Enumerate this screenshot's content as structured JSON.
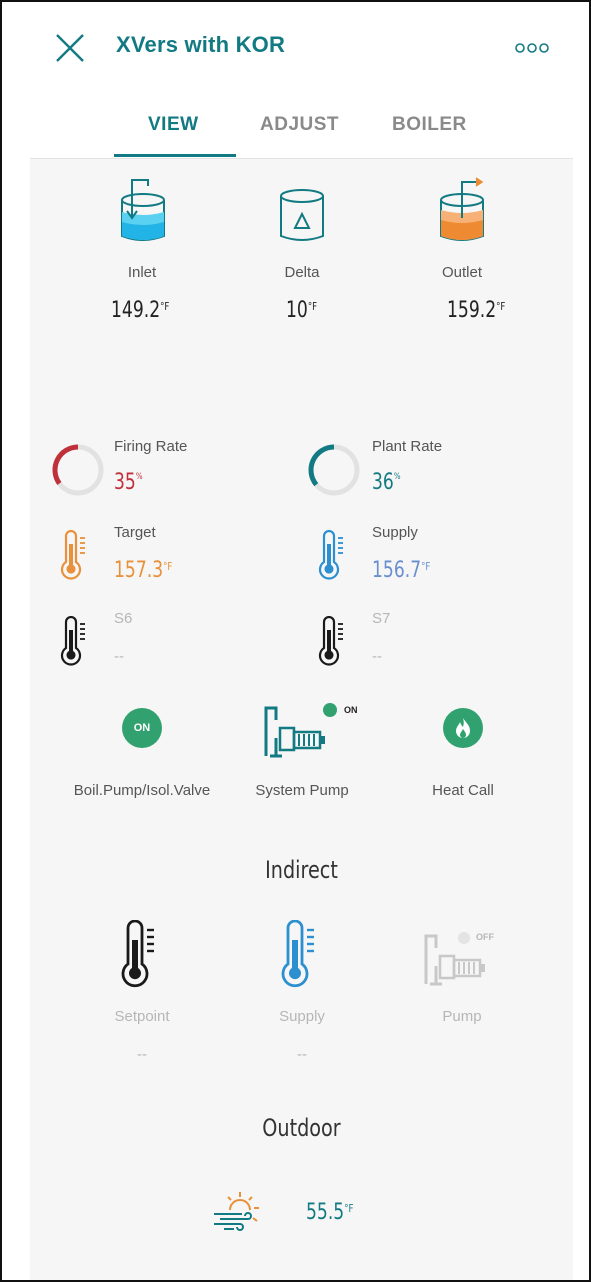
{
  "header": {
    "title": "XVers with KOR",
    "tabs": [
      "VIEW",
      "ADJUST",
      "BOILER"
    ]
  },
  "tank": {
    "inlet_label": "Inlet",
    "inlet_value": "149.2",
    "delta_label": "Delta",
    "delta_value": "10",
    "outlet_label": "Outlet",
    "outlet_value": "159.2",
    "unit": "°F"
  },
  "rates": {
    "firing_label": "Firing Rate",
    "firing_value": "35",
    "firing_percent": 35,
    "plant_label": "Plant Rate",
    "plant_value": "36",
    "plant_percent": 36,
    "pct": "%"
  },
  "temps": {
    "target_label": "Target",
    "target_value": "157.3",
    "supply_label": "Supply",
    "supply_value": "156.7",
    "s6_label": "S6",
    "s6_value": "--",
    "s7_label": "S7",
    "s7_value": "--",
    "unit": "°F"
  },
  "pumps": {
    "boil_badge": "ON",
    "boil_label": "Boil.Pump/Isol.Valve",
    "system_status": "ON",
    "system_label": "System Pump",
    "heat_label": "Heat Call"
  },
  "indirect": {
    "title": "Indirect",
    "setpoint_label": "Setpoint",
    "setpoint_value": "--",
    "supply_label": "Supply",
    "supply_value": "--",
    "pump_label": "Pump",
    "pump_status": "OFF"
  },
  "outdoor": {
    "title": "Outdoor",
    "value": "55.5",
    "unit": "°F"
  },
  "colors": {
    "teal": "#127a82",
    "red": "#c0303a",
    "orange": "#e8913a",
    "blue": "#2c8fd0",
    "green": "#31a26f",
    "muted": "#b6b6b6"
  }
}
